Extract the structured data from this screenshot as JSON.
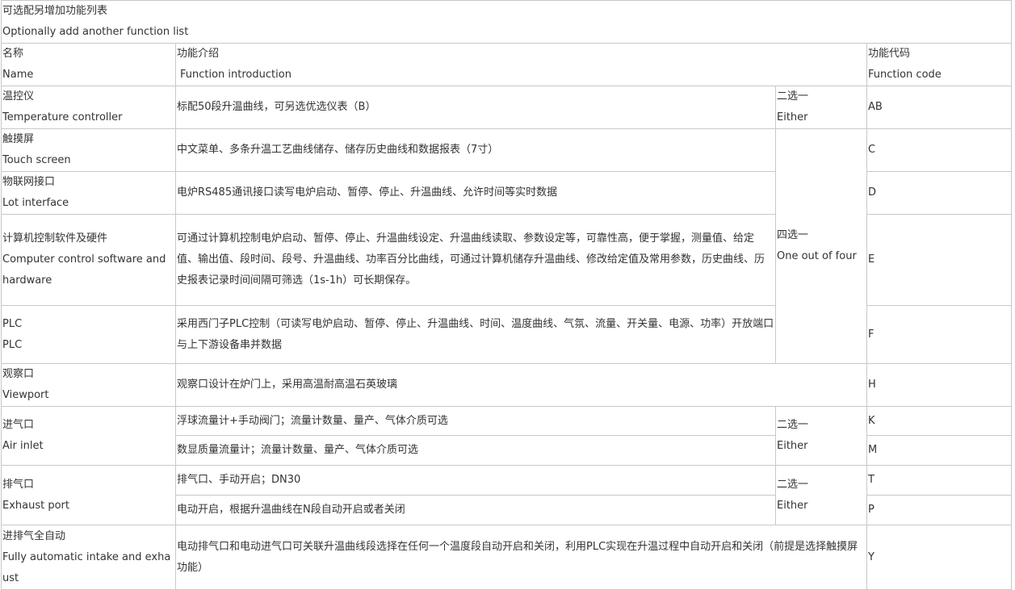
{
  "header": {
    "title_cn": "可选配另增加功能列表",
    "title_en": "Optionally add another function list"
  },
  "columns": {
    "name_cn": "名称",
    "name_en": "Name",
    "intro_cn": "功能介绍",
    "intro_en": "Function introduction",
    "code_cn": "功能代码",
    "code_en": "Function code"
  },
  "choice": {
    "either_cn": "二选一",
    "either_en": "Either",
    "one_of_four_cn": "四选一",
    "one_of_four_en": "One out of four"
  },
  "rows": [
    {
      "name_cn": "温控仪",
      "name_en": "Temperature controller",
      "intro": "标配50段升温曲线，可另选优选仪表（B）",
      "code": "AB"
    },
    {
      "name_cn": "触摸屏",
      "name_en": "Touch screen",
      "intro": "中文菜单、多条升温工艺曲线储存、储存历史曲线和数据报表（7寸）",
      "code": "C"
    },
    {
      "name_cn": "物联网接口",
      "name_en": "Lot interface",
      "intro": "电炉RS485通讯接口读写电炉启动、暂停、停止、升温曲线、允许时间等实时数据",
      "code": "D"
    },
    {
      "name_cn": "计算机控制软件及硬件",
      "name_en": "Computer control software and hardware",
      "intro": "可通过计算机控制电炉启动、暂停、停止、升温曲线设定、升温曲线读取、参数设定等，可靠性高，便于掌握，测量值、给定值、输出值、段时间、段号、升温曲线、功率百分比曲线，可通过计算机储存升温曲线、修改给定值及常用参数，历史曲线、历史报表记录时间间隔可筛选（1s-1h）可长期保存。",
      "code": "E"
    },
    {
      "name_cn": "PLC",
      "name_en": "PLC",
      "intro": "采用西门子PLC控制（可读写电炉启动、暂停、停止、升温曲线、时间、温度曲线、气氛、流量、开关量、电源、功率）开放端口与上下游设备串并数据",
      "code": "F"
    },
    {
      "name_cn": "观察口",
      "name_en": "Viewport",
      "intro": "观察口设计在炉门上，采用高温耐高温石英玻璃",
      "code": "H"
    },
    {
      "name_cn": "进气口",
      "name_en": "Air inlet",
      "options": [
        {
          "intro": "浮球流量计+手动阀门；流量计数量、量产、气体介质可选",
          "code": "K"
        },
        {
          "intro": "数显质量流量计；流量计数量、量产、气体介质可选",
          "code": "M"
        }
      ]
    },
    {
      "name_cn": "排气口",
      "name_en": "Exhaust port",
      "options": [
        {
          "intro": "排气口、手动开启；DN30",
          "code": "T"
        },
        {
          "intro": "电动开启，根据升温曲线在N段自动开启或者关闭",
          "code": "P"
        }
      ]
    },
    {
      "name_cn": "进排气全自动",
      "name_en": "Fully automatic intake and exhaust",
      "intro": "电动排气口和电动进气口可关联升温曲线段选择在任何一个温度段自动开启和关闭，利用PLC实现在升温过程中自动开启和关闭（前提是选择触摸屏功能）",
      "code": "Y"
    }
  ]
}
